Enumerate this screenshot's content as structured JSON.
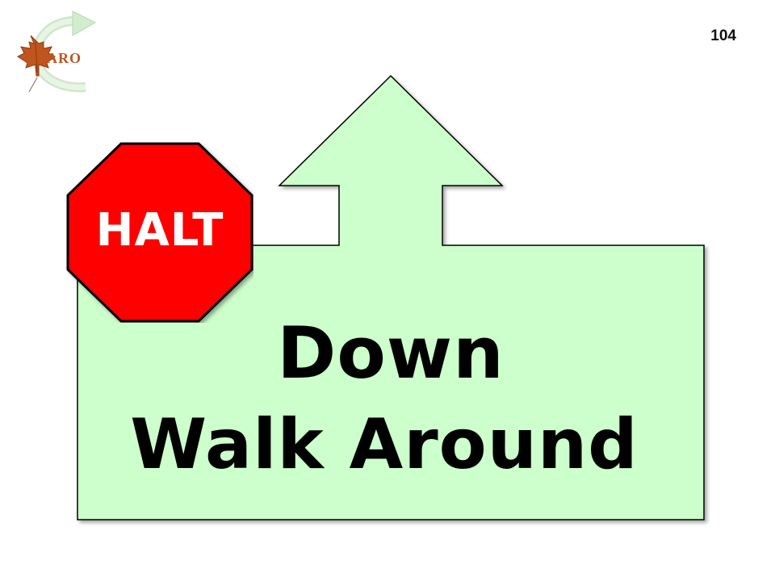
{
  "slide": {
    "page_number": "104",
    "logo": {
      "text": "ARO",
      "icon": "maple-leaf-icon",
      "arrow_icon": "curved-arrow-icon"
    },
    "sign": {
      "halt_label": "HALT",
      "line1": "Down",
      "line2": "Walk Around",
      "colors": {
        "sign_fill": "#ccffcc",
        "stop_fill": "#ff0000",
        "text": "#000000",
        "halt_text": "#ffffff"
      },
      "icon": "up-arrow-icon"
    }
  }
}
